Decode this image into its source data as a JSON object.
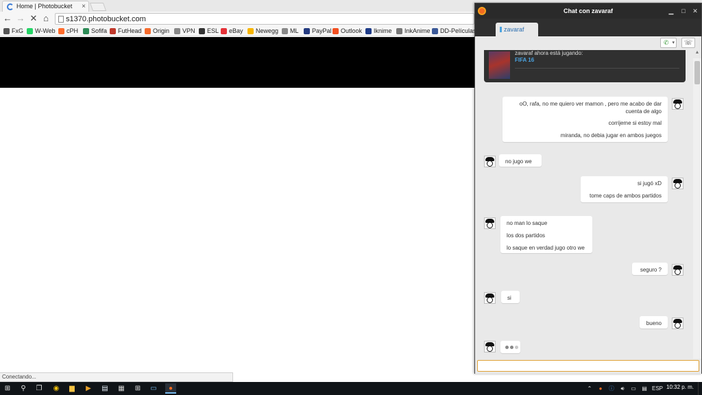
{
  "browser": {
    "tab_title": "Home | Photobucket",
    "tab_close": "×",
    "url": "s1370.photobucket.com",
    "nav": {
      "back": "←",
      "forward": "→",
      "reload": "✕",
      "home": "⌂"
    },
    "bookmarks": [
      {
        "label": "FxG",
        "color": "#555555"
      },
      {
        "label": "W-Web",
        "color": "#25d366"
      },
      {
        "label": "cPH",
        "color": "#ff6c2c"
      },
      {
        "label": "Sofifa",
        "color": "#2e8b57"
      },
      {
        "label": "FutHead",
        "color": "#c0392b"
      },
      {
        "label": "Origin",
        "color": "#f56c2d"
      },
      {
        "label": "VPN",
        "color": "#888888"
      },
      {
        "label": "ESL",
        "color": "#333333"
      },
      {
        "label": "eBay",
        "color": "#e53238"
      },
      {
        "label": "Newegg",
        "color": "#f7b500"
      },
      {
        "label": "ML",
        "color": "#888888"
      },
      {
        "label": "PayPal",
        "color": "#253b80"
      },
      {
        "label": "Outlook",
        "color": "#f25022"
      },
      {
        "label": "Iknime",
        "color": "#1f3c88"
      },
      {
        "label": "InkAnime",
        "color": "#777777"
      },
      {
        "label": "DD-Películas",
        "color": "#3b5998"
      }
    ],
    "status": "Conectando..."
  },
  "chat": {
    "window_title": "Chat con zavaraf",
    "window_buttons": {
      "minimize": "▁",
      "maximize": "□",
      "close": "✕"
    },
    "tab_label": "zavaraf",
    "call_icon": "✆",
    "call_dropdown": "▾",
    "more_icon": "☏",
    "game_status": "zavaraf ahora está jugando:",
    "game_name": "FIFA 16",
    "messages": [
      {
        "lines": [
          "oO, rafa, no me quiero ver mamon , pero me acabo de dar",
          "cuenta de algo",
          "corrijeme si estoy mal",
          "miranda, no debia jugar en ambos juegos"
        ]
      },
      {
        "lines": [
          "no jugo we"
        ]
      },
      {
        "lines": [
          "si jugó xD",
          "tome caps de ambos partidos"
        ]
      },
      {
        "lines": [
          "no man lo saque",
          "los dos partidos",
          "lo saque en verdad jugo otro we"
        ]
      },
      {
        "lines": [
          "seguro ?"
        ]
      },
      {
        "lines": [
          "si"
        ]
      },
      {
        "lines": [
          "bueno"
        ]
      }
    ],
    "input_value": ""
  },
  "taskbar": {
    "start": "⊞",
    "search": "⚲",
    "task_view": "❐",
    "apps": [
      "Chrome",
      "File Explorer",
      "Media Player",
      "Notepad",
      "Calculator",
      "Store",
      "Remote Desktop",
      "Origin"
    ],
    "tray_language": "ESP",
    "clock": "10:32 p. m."
  }
}
